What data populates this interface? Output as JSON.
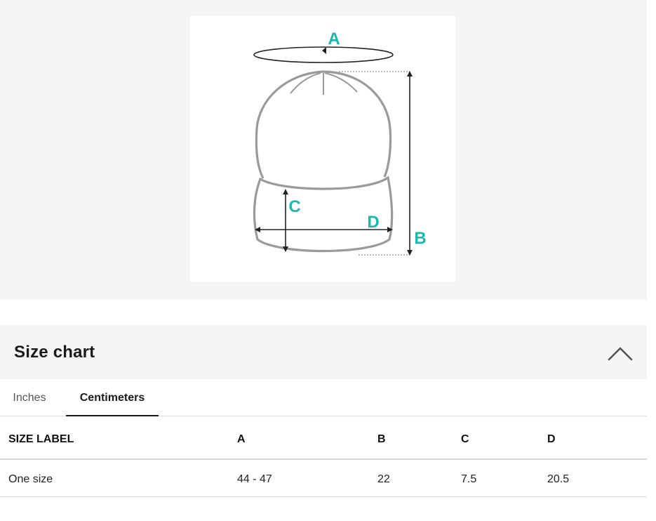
{
  "diagram": {
    "labels": {
      "a": "A",
      "b": "B",
      "c": "C",
      "d": "D"
    },
    "accent_color": "#1bb8b0",
    "outline_color": "#9a9a9a"
  },
  "size_chart": {
    "title": "Size chart",
    "collapse_icon": "chevron-up-icon",
    "tabs": [
      {
        "label": "Inches",
        "active": false
      },
      {
        "label": "Centimeters",
        "active": true
      }
    ],
    "columns": [
      "SIZE LABEL",
      "A",
      "B",
      "C",
      "D"
    ],
    "rows": [
      [
        "One size",
        "44 - 47",
        "22",
        "7.5",
        "20.5"
      ]
    ]
  }
}
